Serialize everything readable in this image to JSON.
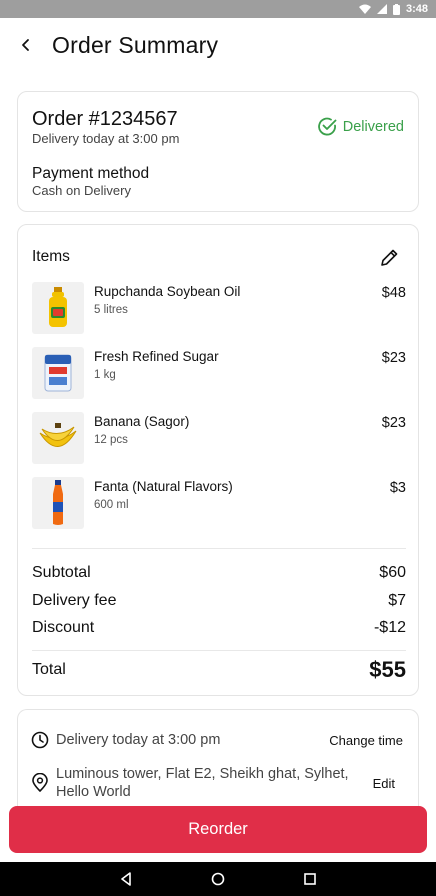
{
  "status_bar": {
    "time": "3:48"
  },
  "header": {
    "title": "Order Summary",
    "back_icon": "arrow-left-icon"
  },
  "order": {
    "id": "Order #1234567",
    "delivery_time": "Delivery today at 3:00 pm",
    "status": "Delivered",
    "status_color": "#3aa04a",
    "payment_label": "Payment method",
    "payment_value": "Cash on Delivery"
  },
  "items_section": {
    "title": "Items",
    "edit_icon": "pencil-icon",
    "items": [
      {
        "name": "Rupchanda Soybean Oil",
        "qty": "5 litres",
        "price": "$48",
        "thumb": "oil-bottle-icon"
      },
      {
        "name": "Fresh Refined Sugar",
        "qty": "1 kg",
        "price": "$23",
        "thumb": "sugar-bag-icon"
      },
      {
        "name": "Banana (Sagor)",
        "qty": "12 pcs",
        "price": "$23",
        "thumb": "banana-icon"
      },
      {
        "name": "Fanta (Natural Flavors)",
        "qty": "600 ml",
        "price": "$3",
        "thumb": "soda-bottle-icon"
      }
    ]
  },
  "summary": {
    "subtotal_label": "Subtotal",
    "subtotal_value": "$60",
    "delivery_label": "Delivery fee",
    "delivery_value": "$7",
    "discount_label": "Discount",
    "discount_value": "-$12",
    "total_label": "Total",
    "total_value": "$55"
  },
  "delivery": {
    "time_text": "Delivery today at 3:00 pm",
    "change_time_label": "Change time",
    "address_text": "Luminous tower, Flat E2, Sheikh ghat, Sylhet, Hello World",
    "edit_label": "Edit"
  },
  "actions": {
    "reorder_label": "Reorder",
    "reorder_color": "#e02e48"
  }
}
